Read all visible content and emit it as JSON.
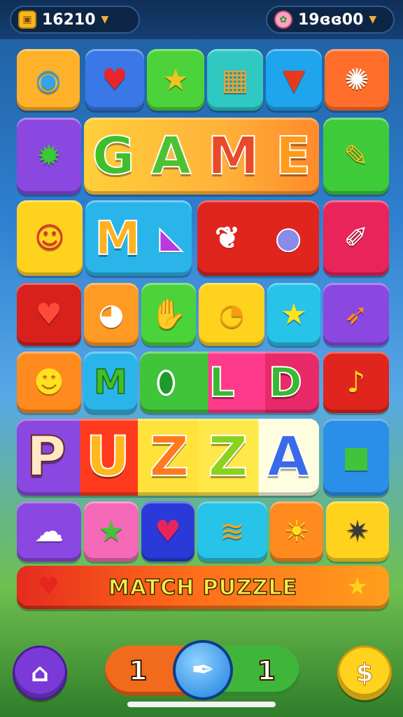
{
  "hud": {
    "coins": "16210",
    "gems": "19ɞɞ00",
    "coins_icon": "coin-chest-icon",
    "gems_icon": "radish-icon"
  },
  "board": {
    "row1": [
      "fish",
      "apple",
      "star",
      "crate",
      "carrot",
      "splat"
    ],
    "word_game": [
      "G",
      "A",
      "M",
      "E"
    ],
    "word_m": [
      "M"
    ],
    "word_ld": [
      "L",
      "D"
    ],
    "word_m2": [
      "M"
    ],
    "word_puzza": [
      "P",
      "U",
      "Z",
      "Z",
      "A"
    ]
  },
  "banner": {
    "title": "MATCH PUZZLE"
  },
  "controls": {
    "left_count": "1",
    "right_count": "1"
  },
  "colors": {
    "accent_orange": "#f26a1b",
    "accent_green": "#3fb63a",
    "accent_blue": "#1d7fe0"
  }
}
